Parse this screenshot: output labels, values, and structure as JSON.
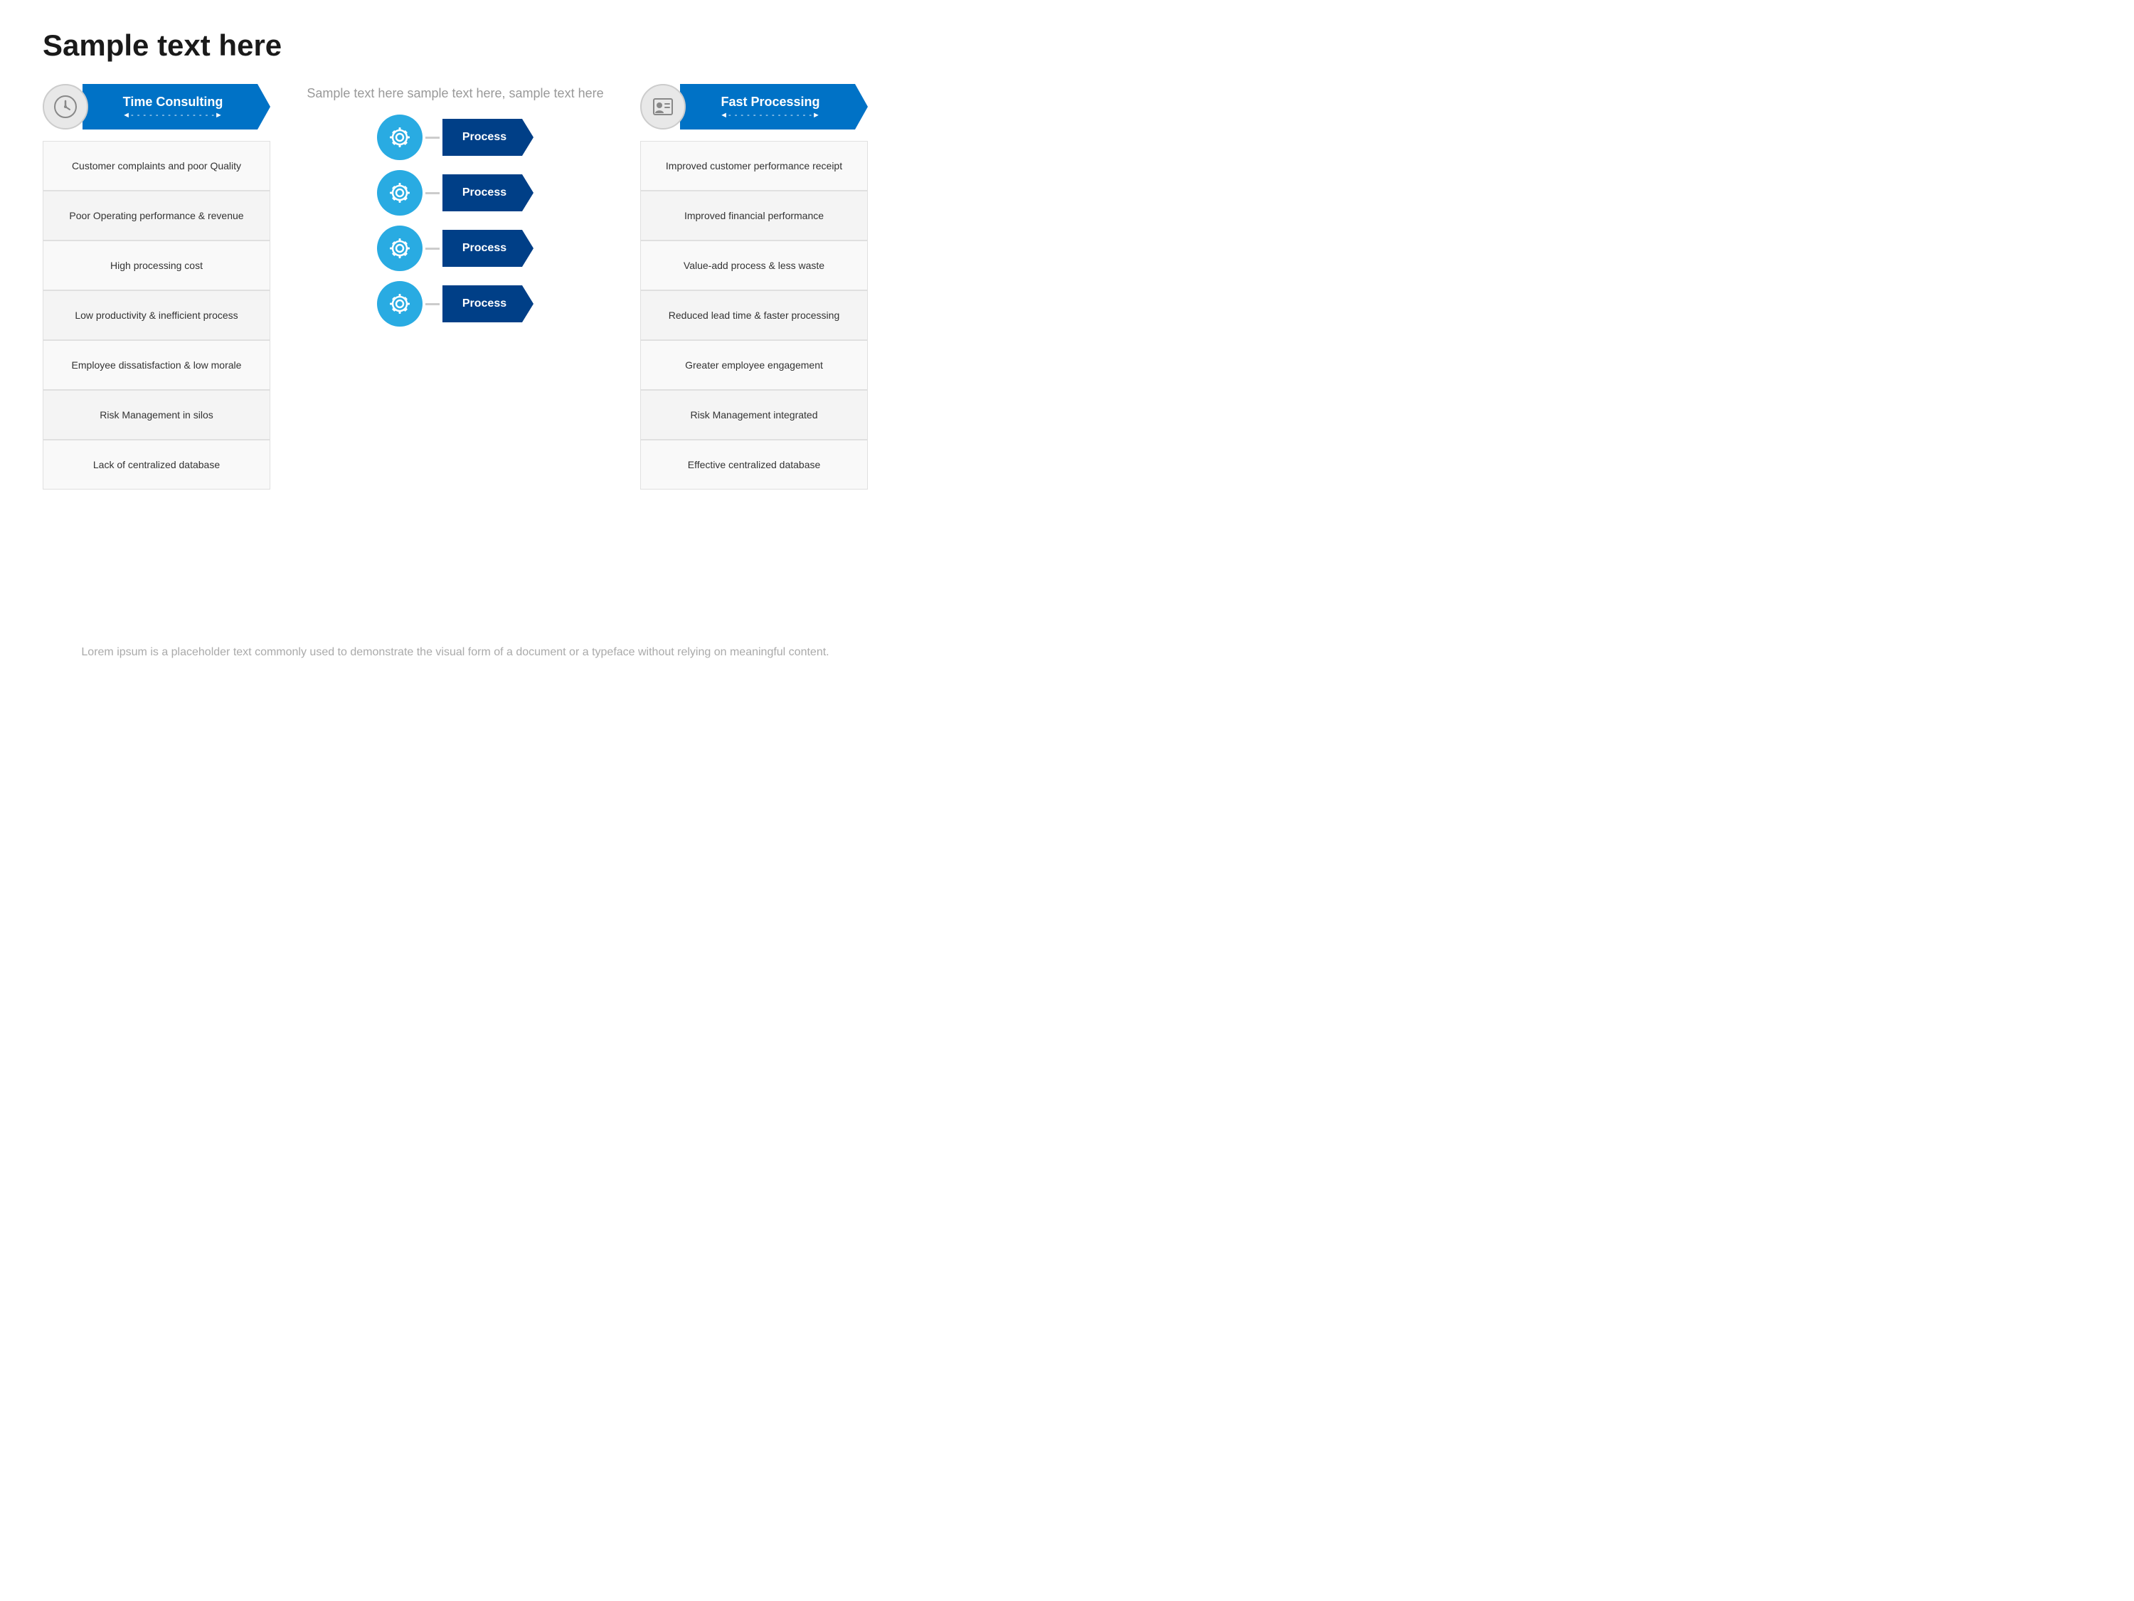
{
  "title": "Sample text here",
  "left_banner": {
    "label": "Time Consulting",
    "subtitle": "◄- - - - - - - - - - - - - -►"
  },
  "right_banner": {
    "label": "Fast Processing",
    "subtitle": "◄- - - - - - - - - - - - - -►"
  },
  "sample_text": "Sample text here sample text here, sample text here",
  "left_items": [
    "Customer complaints and poor Quality",
    "Poor Operating performance & revenue",
    "High processing cost",
    "Low productivity & inefficient process",
    "Employee dissatisfaction & low morale",
    "Risk Management in silos",
    "Lack of centralized database"
  ],
  "right_items": [
    "Improved customer performance receipt",
    "Improved financial performance",
    "Value-add process & less waste",
    "Reduced lead time & faster processing",
    "Greater employee engagement",
    "Risk Management integrated",
    "Effective centralized database"
  ],
  "process_labels": [
    "Process",
    "Process",
    "Process",
    "Process"
  ],
  "footer": "Lorem ipsum is a placeholder text commonly used to demonstrate the visual form of a document or a typeface without relying on meaningful content."
}
